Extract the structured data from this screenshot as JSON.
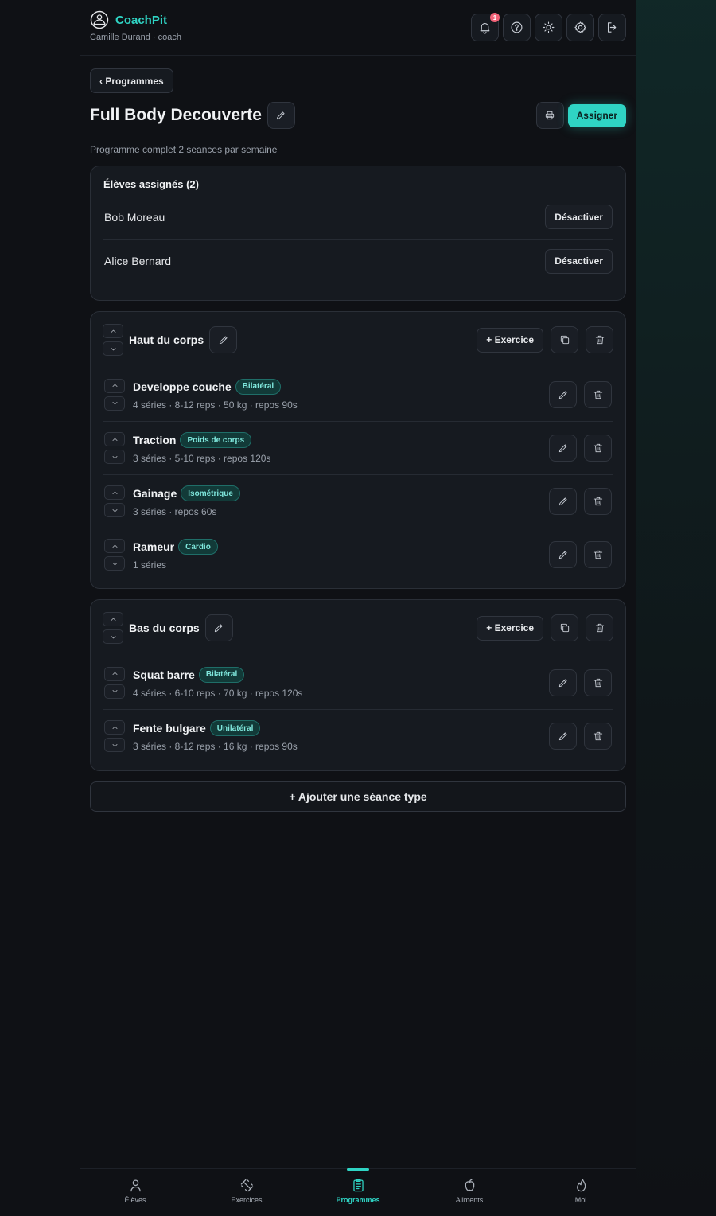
{
  "app": {
    "name": "CoachPit",
    "user": "Camille Durand · coach"
  },
  "header": {
    "notifications_count": "1"
  },
  "nav": {
    "back_label": "‹ Programmes"
  },
  "program": {
    "title": "Full Body Decouverte",
    "description": "Programme complet 2 seances par semaine",
    "assign_label": "Assigner"
  },
  "students": {
    "title": "Élèves assignés (2)",
    "items": [
      {
        "name": "Bob Moreau",
        "action": "Désactiver"
      },
      {
        "name": "Alice Bernard",
        "action": "Désactiver"
      }
    ]
  },
  "sessions": [
    {
      "name": "Haut du corps",
      "add_exercise_label": "+ Exercice",
      "exercises": [
        {
          "name": "Developpe couche",
          "tag": "Bilatéral",
          "meta": "4 séries · 8-12 reps · 50 kg · repos 90s"
        },
        {
          "name": "Traction",
          "tag": "Poids de corps",
          "meta": "3 séries · 5-10 reps · repos 120s"
        },
        {
          "name": "Gainage",
          "tag": "Isométrique",
          "meta": "3 séries · repos 60s"
        },
        {
          "name": "Rameur",
          "tag": "Cardio",
          "meta": "1 séries"
        }
      ]
    },
    {
      "name": "Bas du corps",
      "add_exercise_label": "+ Exercice",
      "exercises": [
        {
          "name": "Squat barre",
          "tag": "Bilatéral",
          "meta": "4 séries · 6-10 reps · 70 kg · repos 120s"
        },
        {
          "name": "Fente bulgare",
          "tag": "Unilatéral",
          "meta": "3 séries · 8-12 reps · 16 kg · repos 90s"
        }
      ]
    }
  ],
  "add_session_label": "+ Ajouter une séance type",
  "bottom_nav": [
    {
      "label": "Élèves",
      "icon": "user-icon",
      "active": false
    },
    {
      "label": "Exercices",
      "icon": "dumbbell-icon",
      "active": false
    },
    {
      "label": "Programmes",
      "icon": "clipboard-icon",
      "active": true
    },
    {
      "label": "Aliments",
      "icon": "apple-icon",
      "active": false
    },
    {
      "label": "Moi",
      "icon": "flame-icon",
      "active": false
    }
  ],
  "colors": {
    "accent": "#2fd4c4",
    "background": "#0f1115",
    "card": "#161a20",
    "badge": "#f06277"
  }
}
